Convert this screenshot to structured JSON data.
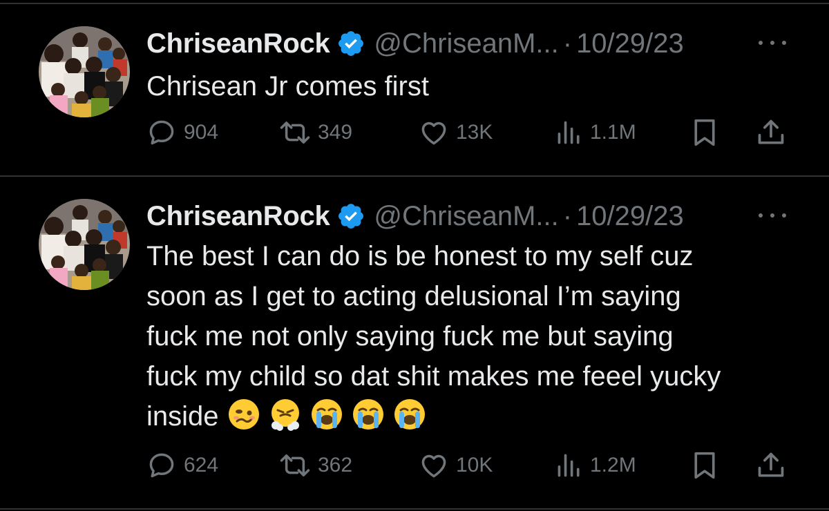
{
  "tweets": [
    {
      "display_name": "ChriseanRock",
      "handle": "@ChriseanM...",
      "separator": "·",
      "date": "10/29/23",
      "text_lines": [
        "Chrisean Jr comes first"
      ],
      "emojis": [],
      "metrics": {
        "replies": "904",
        "retweets": "349",
        "likes": "13K",
        "views": "1.1M"
      }
    },
    {
      "display_name": "ChriseanRock",
      "handle": "@ChriseanM...",
      "separator": "·",
      "date": "10/29/23",
      "text_lines": [
        "The best I can do is be honest to my self cuz",
        "soon as I get to acting delusional I’m saying",
        "fuck me not only saying fuck me but saying",
        "fuck my child so dat shit makes me feeel yucky",
        "inside"
      ],
      "emojis": [
        "woozy-face",
        "face-with-steam-from-nose",
        "loudly-crying-face",
        "loudly-crying-face",
        "loudly-crying-face"
      ],
      "metrics": {
        "replies": "624",
        "retweets": "362",
        "likes": "10K",
        "views": "1.2M"
      }
    }
  ],
  "icons": {
    "reply": "speech-bubble-icon",
    "retweet": "retweet-icon",
    "like": "heart-icon",
    "views": "bar-chart-icon",
    "bookmark": "bookmark-icon",
    "share": "share-icon",
    "verified": "verified-badge-icon",
    "more": "more-dots-icon"
  },
  "colors": {
    "background": "#000000",
    "primary_text": "#e7e9ea",
    "secondary_text": "#71767b",
    "verified_blue": "#1d9bf0",
    "divider": "#2f3336"
  }
}
